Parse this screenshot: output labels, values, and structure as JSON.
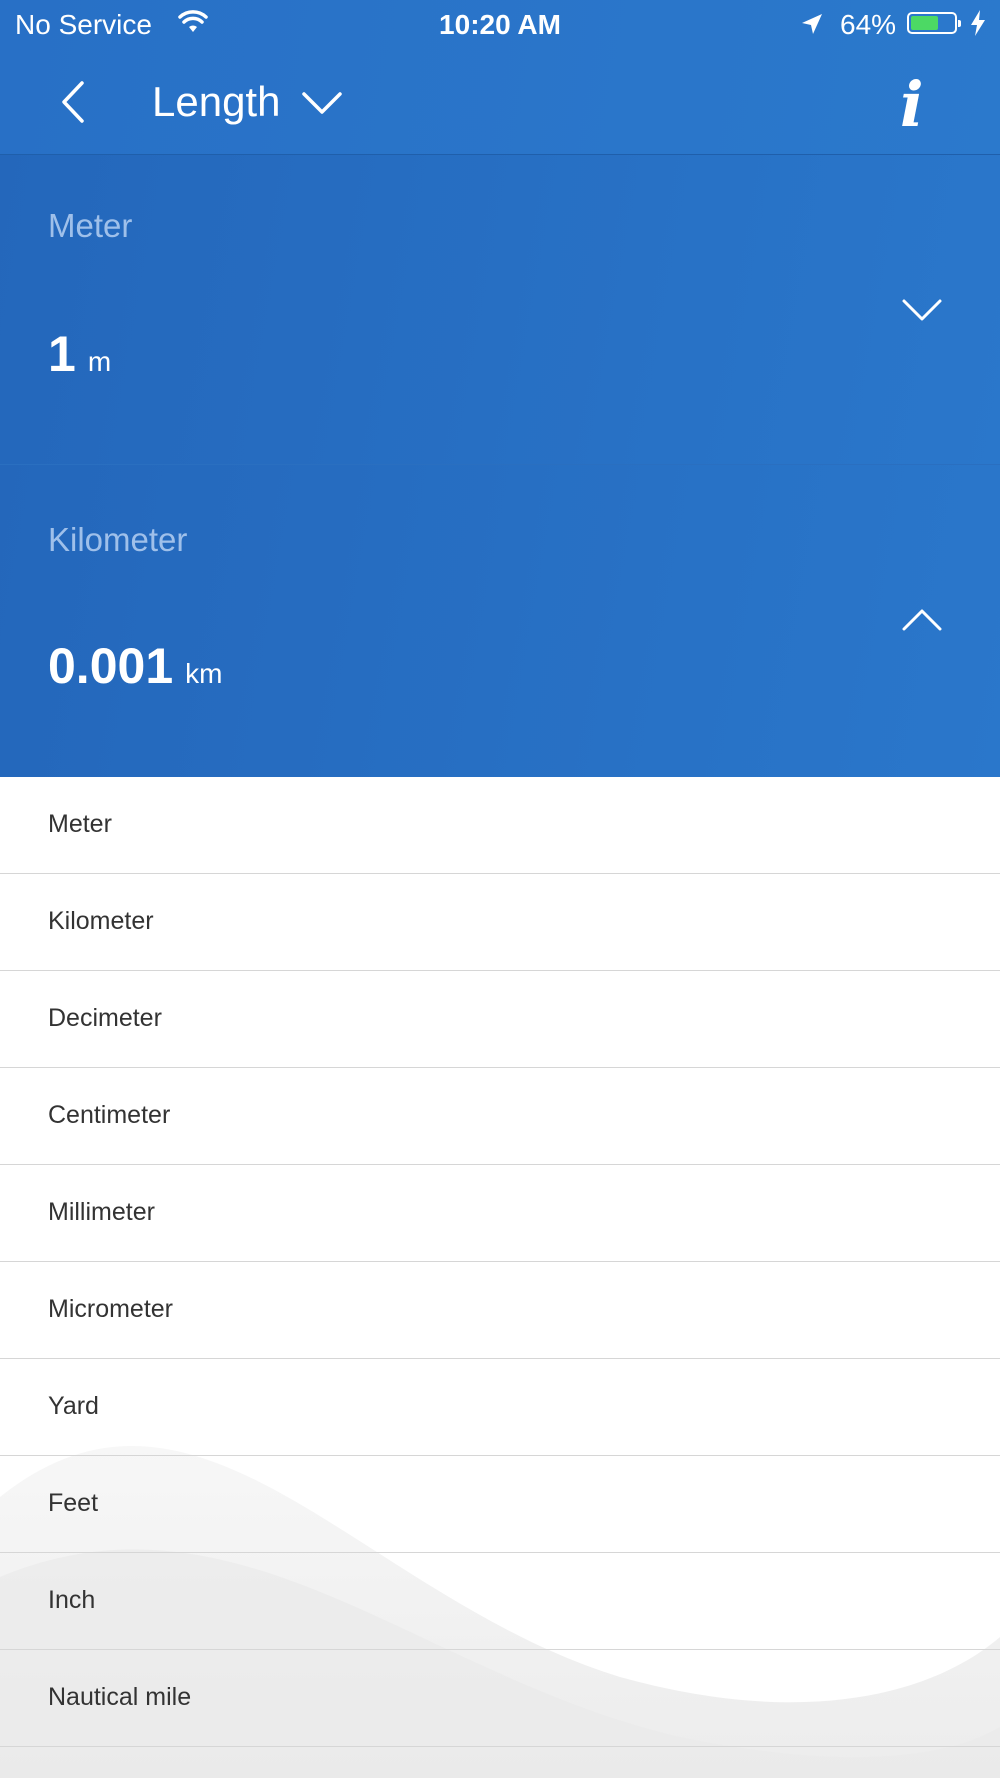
{
  "status_bar": {
    "carrier": "No Service",
    "time": "10:20 AM",
    "battery_percent": "64%",
    "battery_level": 0.64,
    "battery_color": "#4cd964"
  },
  "nav": {
    "title": "Length",
    "info_label": "i"
  },
  "converter": {
    "from": {
      "unit_name": "Meter",
      "value": "1",
      "symbol": "m"
    },
    "to": {
      "unit_name": "Kilometer",
      "value": "0.001",
      "symbol": "km"
    }
  },
  "unit_list": [
    "Meter",
    "Kilometer",
    "Decimeter",
    "Centimeter",
    "Millimeter",
    "Micrometer",
    "Yard",
    "Feet",
    "Inch",
    "Nautical mile"
  ],
  "colors": {
    "accent_blue": "#2870c6",
    "secondary_label": "#9fc0ea"
  }
}
